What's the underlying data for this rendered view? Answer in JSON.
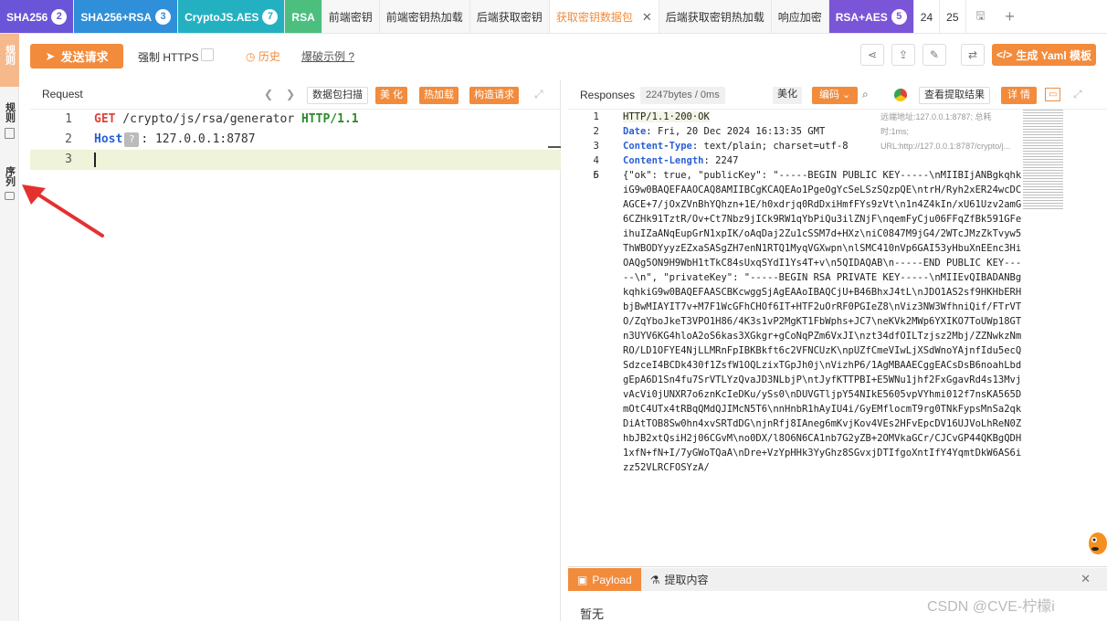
{
  "tabs": [
    {
      "label": "SHA256",
      "badge": "2",
      "color": "#6a55d8",
      "kind": "group"
    },
    {
      "label": "SHA256+RSA",
      "badge": "3",
      "color": "#2f8fd8",
      "kind": "group"
    },
    {
      "label": "CryptoJS.AES",
      "badge": "7",
      "color": "#23b1c2",
      "kind": "group"
    },
    {
      "label": "RSA",
      "badge": "",
      "color": "#4cbf7f",
      "kind": "group"
    },
    {
      "label": "前端密钥",
      "kind": "tab"
    },
    {
      "label": "前端密钥热加载",
      "kind": "tab"
    },
    {
      "label": "后端获取密钥",
      "kind": "tab"
    },
    {
      "label": "获取密钥数据包",
      "kind": "active"
    },
    {
      "label": "后端获取密钥热加载",
      "kind": "tab"
    },
    {
      "label": "响应加密",
      "kind": "tab"
    },
    {
      "label": "RSA+AES",
      "badge": "5",
      "color": "#7b55d8",
      "kind": "group"
    },
    {
      "label": "24",
      "kind": "num"
    },
    {
      "label": "25",
      "kind": "num"
    }
  ],
  "sidebar": {
    "top": "规则",
    "mid": "规则",
    "bottom": "序列"
  },
  "toolbar": {
    "send_label": "发送请求",
    "https_label": "强制 HTTPS",
    "history_label": "历史",
    "examples_label": "爆破示例",
    "yaml_label": "生成 Yaml 模板"
  },
  "request": {
    "title": "Request",
    "packet_scan": "数据包扫描",
    "beautify": "美 化",
    "hot_load": "热加载",
    "build_request": "构造请求",
    "lines": [
      {
        "num": "1",
        "method": "GET",
        "path": " /crypto/js/rsa/generator ",
        "proto": "HTTP/1.1"
      },
      {
        "num": "2",
        "key": "Host",
        "rest": ": 127.0.0.1:8787"
      },
      {
        "num": "3"
      }
    ]
  },
  "response": {
    "title": "Responses",
    "bytes": "2247bytes / 0ms",
    "beautify": "美化",
    "encoding": "编码",
    "view_extract": "查看提取结果",
    "detail": "详 情",
    "side_note": "远端地址:127.0.0.1:8787; 总耗时:1ms; URL:http://127.0.0.1:8787/crypto/j...",
    "lines": [
      {
        "num": "1",
        "text": "HTTP/1.1·200·OK"
      },
      {
        "num": "2",
        "key": "Date",
        "text": ": Fri, 20 Dec 2024 16:13:35 GMT"
      },
      {
        "num": "3",
        "key": "Content-Type",
        "text": ": text/plain; charset=utf-8"
      },
      {
        "num": "4",
        "key": "Content-Length",
        "text": ": 2247"
      },
      {
        "num": "5",
        "text": ""
      },
      {
        "num": "6",
        "text": "{\"ok\": true, \"publicKey\": \"-----BEGIN PUBLIC KEY-----\\nMIIBIjANBgkqhkiG9w0BAQEFAAOCAQ8AMIIBCgKCAQEAo1PgeOgYcSeLSzSQzpQE\\ntrH/Ryh2xER24wcDCAGCE+7/jOxZVnBhYQhzn+1E/h0xdrjq0RdDxiHmfFYs9zVt\\n1n4Z4kIn/xU61Uzv2amG6CZHk91TztR/Ov+Ct7Nbz9jICk9RW1qYbPiQu3ilZNjF\\nqemFyCju06FFqZfBk591GFeihuIZaANqEupGrN1xpIK/oAqDaj2Zu1cSSM7d+HXz\\niC0847M9jG4/2WTcJMzZkTvyw5ThWBODYyyzEZxaSASgZH7enN1RTQ1MyqVGXwpn\\nlSMC410nVp6GAI53yHbuXnEEnc3HiOAQg5ON9H9WbH1tTkC84sUxqSYdI1Ys4T+v\\n5QIDAQAB\\n-----END PUBLIC KEY-----\\n\", \"privateKey\": \"-----BEGIN RSA PRIVATE KEY-----\\nMIIEvQIBADANBgkqhkiG9w0BAQEFAASCBKcwggSjAgEAAoIBAQCjU+B46BhxJ4tL\\nJDO1AS2sf9HKHbERHbjBwMIAYIT7v+M7F1WcGFhCHOf6IT+HTF2uOrRF0PGIeZ8\\nViz3NW3WfhniQif/FTrVTO/ZqYboJkeT3VPO1H86/4K3s1vP2MgKT1FbWphs+JC7\\neKVk2MWp6YXIKO7ToUWp18GTn3UYV6KG4hloA2oS6kas3XGkgr+gCoNqPZm6VxJI\\nzt34dfOILTzjsz2Mbj/ZZNwkzNmRO/LD1OFYE4NjLLMRnFpIBKBkft6c2VFNCUzK\\npUZfCmeVIwLjXSdWnoYAjnfIdu5ecQSdzceI4BCDk430f1ZsfW1OQLzixTGpJh0j\\nVizhP6/1AgMBAAECggEACsDsB6noahLbdgEpA6D1Sn4fu7SrVTLYzQvaJD3NLbjP\\ntJyfKTTPBI+E5WNu1jhf2FxGgavRd4s13MvjvAcVi0jUNXR7o6znKcIeDKu/ySs0\\nDUVGTljpY54NIkE5605vpVYhmi012f7nsKA565DmOtC4UTx4tRBqQMdQJIMcN5T6\\nnHnbR1hAyIU4i/GyEMflocmT9rg0TNkFypsMnSa2qkDiAtTOB8Sw0hn4xvSRTdDG\\njnRfj8IAneg6mKvjKov4VEs2HFvEpcDV16UJVoLhReN0ZhbJB2xtQsiH2j06CGvM\\no0DX/l8O6N6CA1nb7G2yZB+2OMVkaGCr/CJCvGP44QKBgQDH1xfN+fN+I/7yGWoTQaA\\nDre+VzYpHHk3YyGhz8SGvxjDTIfgoXntIfY4YqmtDkW6AS6izz52VLRCFOSYzA/"
      }
    ]
  },
  "bottom": {
    "payload": "Payload",
    "extract": "提取内容",
    "empty": "暂无"
  },
  "watermark": "CSDN @CVE-柠檬i"
}
